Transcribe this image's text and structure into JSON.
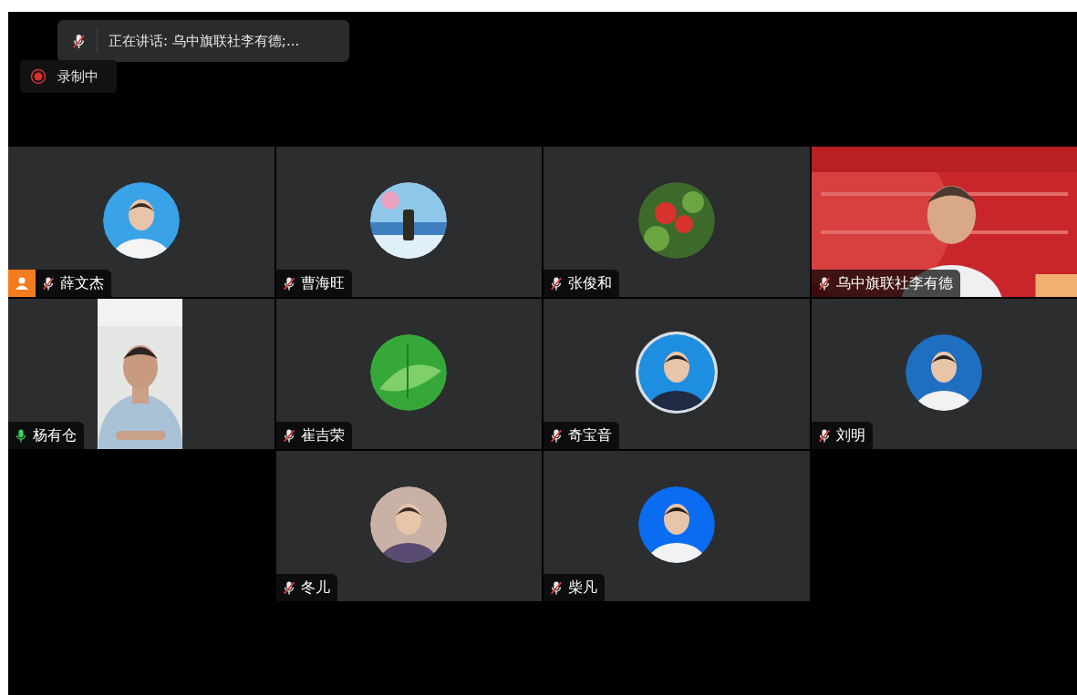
{
  "speaking_toast": {
    "muted": true,
    "text": "正在讲话: 乌中旗联社李有德;..."
  },
  "recording": {
    "label": "录制中"
  },
  "rows": [
    [
      {
        "name": "薛文杰",
        "muted": true,
        "host": true,
        "kind": "avatar"
      },
      {
        "name": "曹海旺",
        "muted": true,
        "host": false,
        "kind": "avatar"
      },
      {
        "name": "张俊和",
        "muted": true,
        "host": false,
        "kind": "avatar"
      },
      {
        "name": "乌中旗联社李有德",
        "muted": true,
        "host": false,
        "kind": "video"
      }
    ],
    [
      {
        "name": "杨有仓",
        "muted": false,
        "host": false,
        "kind": "camera"
      },
      {
        "name": "崔吉荣",
        "muted": true,
        "host": false,
        "kind": "avatar"
      },
      {
        "name": "奇宝音",
        "muted": true,
        "host": false,
        "kind": "avatar"
      },
      {
        "name": "刘明",
        "muted": true,
        "host": false,
        "kind": "avatar"
      }
    ],
    [
      {
        "name": "冬儿",
        "muted": true,
        "host": false,
        "kind": "avatar"
      },
      {
        "name": "柴凡",
        "muted": true,
        "host": false,
        "kind": "avatar"
      }
    ]
  ]
}
